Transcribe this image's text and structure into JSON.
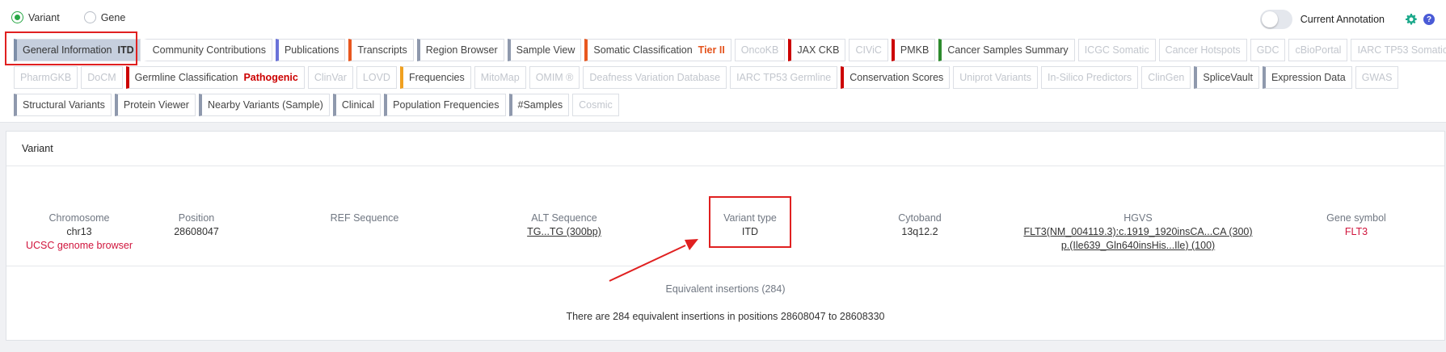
{
  "radios": [
    {
      "label": "Variant",
      "checked": true
    },
    {
      "label": "Gene",
      "checked": false
    }
  ],
  "annotation_toggle": {
    "label": "Current Annotation",
    "on": false
  },
  "icons": {
    "settings": "gear-icon",
    "help": "help-icon"
  },
  "help_glyph": "?",
  "tabs_row1": [
    {
      "label": "General Information",
      "tag": "ITD",
      "tag_color": "dark",
      "color": "#7e8fa9",
      "selected": true,
      "disabled": false
    },
    {
      "label": "Community Contributions",
      "color": "#ffffff",
      "disabled": false
    },
    {
      "label": "Publications",
      "color": "#6b73d9",
      "disabled": false
    },
    {
      "label": "Transcripts",
      "color": "#e8571f",
      "disabled": false
    },
    {
      "label": "Region Browser",
      "color": "#8f99ad",
      "disabled": false
    },
    {
      "label": "Sample View",
      "color": "#8f99ad",
      "disabled": false
    },
    {
      "label": "Somatic Classification",
      "tag": "Tier II",
      "tag_color": "orange",
      "color": "#e8571f",
      "disabled": false
    },
    {
      "label": "OncoKB",
      "disabled": true
    },
    {
      "label": "JAX CKB",
      "color": "#cc0000",
      "disabled": false
    },
    {
      "label": "CIViC",
      "disabled": true
    },
    {
      "label": "PMKB",
      "color": "#cc0000",
      "disabled": false
    },
    {
      "label": "Cancer Samples Summary",
      "color": "#2e8b2e",
      "disabled": false
    },
    {
      "label": "ICGC Somatic",
      "disabled": true
    },
    {
      "label": "Cancer Hotspots",
      "disabled": true
    },
    {
      "label": "GDC",
      "disabled": true
    },
    {
      "label": "cBioPortal",
      "disabled": true
    },
    {
      "label": "IARC TP53 Somatic",
      "disabled": true
    }
  ],
  "tabs_row2": [
    {
      "label": "PharmGKB",
      "disabled": true
    },
    {
      "label": "DoCM",
      "disabled": true
    },
    {
      "label": "Germline Classification",
      "tag": "Pathogenic",
      "tag_color": "red",
      "color": "#cc0000",
      "disabled": false
    },
    {
      "label": "ClinVar",
      "disabled": true
    },
    {
      "label": "LOVD",
      "disabled": true
    },
    {
      "label": "Frequencies",
      "color": "#f0a020",
      "disabled": false
    },
    {
      "label": "MitoMap",
      "disabled": true
    },
    {
      "label": "OMIM ®",
      "disabled": true
    },
    {
      "label": "Deafness Variation Database",
      "disabled": true
    },
    {
      "label": "IARC TP53 Germline",
      "disabled": true
    },
    {
      "label": "Conservation Scores",
      "color": "#cc0000",
      "disabled": false
    },
    {
      "label": "Uniprot Variants",
      "disabled": true
    },
    {
      "label": "In-Silico Predictors",
      "disabled": true
    },
    {
      "label": "ClinGen",
      "disabled": true
    },
    {
      "label": "SpliceVault",
      "color": "#8f99ad",
      "disabled": false
    },
    {
      "label": "Expression Data",
      "color": "#8f99ad",
      "disabled": false
    },
    {
      "label": "GWAS",
      "disabled": true
    }
  ],
  "tabs_row3": [
    {
      "label": "Structural Variants",
      "color": "#8f99ad",
      "disabled": false
    },
    {
      "label": "Protein Viewer",
      "color": "#8f99ad",
      "disabled": false
    },
    {
      "label": "Nearby Variants (Sample)",
      "color": "#8f99ad",
      "disabled": false
    },
    {
      "label": "Clinical",
      "color": "#8f99ad",
      "disabled": false
    },
    {
      "label": "Population Frequencies",
      "color": "#8f99ad",
      "disabled": false
    },
    {
      "label": "#Samples",
      "color": "#8f99ad",
      "disabled": false
    },
    {
      "label": "Cosmic",
      "disabled": true
    }
  ],
  "variant": {
    "title": "Variant",
    "chromosome": {
      "label": "Chromosome",
      "value": "chr13",
      "link": "UCSC genome browser"
    },
    "position": {
      "label": "Position",
      "value": "28608047"
    },
    "ref": {
      "label": "REF Sequence",
      "value": ""
    },
    "alt": {
      "label": "ALT Sequence",
      "value": "TG...TG (300bp)"
    },
    "variant_type": {
      "label": "Variant type",
      "value": "ITD"
    },
    "cytoband": {
      "label": "Cytoband",
      "value": "13q12.2"
    },
    "hgvs": {
      "label": "HGVS",
      "c": "FLT3(NM_004119.3):c.1919_1920insCA...CA (300)",
      "p": "p.(Ile639_Gln640insHis...Ile) (100)"
    },
    "gene_symbol": {
      "label": "Gene symbol",
      "value": "FLT3"
    }
  },
  "equivalent": {
    "title": "Equivalent insertions (284)",
    "text": "There are 284 equivalent insertions in positions 28608047 to 28608330"
  }
}
